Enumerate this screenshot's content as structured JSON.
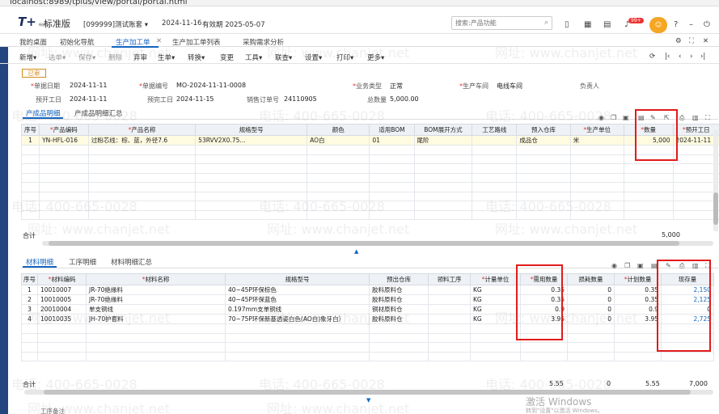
{
  "browser": {
    "url": "localhost:8989/tplus/view/portal/portal.html"
  },
  "header": {
    "logo": "T+",
    "logo_sub": "畅捷通",
    "edition": "标准版",
    "account": "[099999]测试账套",
    "date": "2024-11-16",
    "expiry": "有效期 2025-05-07",
    "search_placeholder": "搜索:产品功能",
    "notification_count": "99+"
  },
  "tabs": [
    {
      "label": "我的桌面"
    },
    {
      "label": "初始化导航"
    },
    {
      "label": "生产加工单"
    },
    {
      "label": "生产加工单列表"
    },
    {
      "label": "采购需求分析"
    }
  ],
  "toolbar": {
    "items": [
      "新增",
      "选单",
      "保存",
      "删除",
      "弃审",
      "生单",
      "转换",
      "变更",
      "工具",
      "联查",
      "设置",
      "打印",
      "更多"
    ]
  },
  "form": {
    "status": "已审",
    "fields": [
      {
        "label": "单据日期",
        "value": "2024-11-11",
        "required": true
      },
      {
        "label": "单据编号",
        "value": "MO-2024-11-11-0008",
        "required": true
      },
      {
        "label": "业务类型",
        "value": "正常",
        "required": true
      },
      {
        "label": "生产车间",
        "value": "电线车间",
        "required": true
      },
      {
        "label": "负责人",
        "value": "",
        "required": false
      },
      {
        "label": "预开工日",
        "value": "2024-11-11",
        "required": false
      },
      {
        "label": "预完工日",
        "value": "2024-11-15",
        "required": false
      },
      {
        "label": "销售订单号",
        "value": "24110905",
        "required": false
      },
      {
        "label": "总数量",
        "value": "5,000.00",
        "required": false
      }
    ]
  },
  "product_tabs": [
    {
      "label": "产成品明细"
    },
    {
      "label": "产成品明细汇总"
    }
  ],
  "product_grid": {
    "headers": [
      "序号",
      "产品编码",
      "产品名称",
      "规格型号",
      "颜色",
      "适用BOM",
      "BOM展开方式",
      "工艺路线",
      "预入仓库",
      "生产单位",
      "数量",
      "预开工日"
    ],
    "rows": [
      [
        "1",
        "YN-HFL-016",
        "过粉芯线：棕、蓝，外径7.6",
        "53RVV2X0.75...",
        "AO白",
        "01",
        "尾阶",
        "",
        "成品仓",
        "米",
        "5,000",
        "2024-11-11"
      ]
    ],
    "total_label": "合计",
    "total_qty": "5,000"
  },
  "material_tabs": [
    {
      "label": "材料明细"
    },
    {
      "label": "工序明细"
    },
    {
      "label": "材料明细汇总"
    }
  ],
  "material_grid": {
    "headers": [
      "序号",
      "材料编码",
      "材料名称",
      "规格型号",
      "预出仓库",
      "领料工序",
      "计量单位",
      "需用数量",
      "损耗数量",
      "计划数量",
      "现存量"
    ],
    "rows": [
      [
        "1",
        "10010007",
        "JR-70绝缘料",
        "40~45P环保棕色",
        "胶料原料仓",
        "",
        "KG",
        "0.35",
        "0",
        "0.35",
        "2,150"
      ],
      [
        "2",
        "10010005",
        "JR-70绝缘料",
        "40~45P环保蓝色",
        "胶料原料仓",
        "",
        "KG",
        "0.35",
        "0",
        "0.35",
        "2,125"
      ],
      [
        "3",
        "20010004",
        "单支铜线",
        "0.197mm支单铜线",
        "铜材原料仓",
        "",
        "KG",
        "0.9",
        "0",
        "0.9",
        "0"
      ],
      [
        "4",
        "10010035",
        "JH-70护套料",
        "70~75P环保新基透姿白色(AO白)象牙白）",
        "胶料原料仓",
        "",
        "KG",
        "3.95",
        "0",
        "3.95",
        "2,725"
      ]
    ],
    "total_label": "合计",
    "total_need": "5.55",
    "total_loss": "0",
    "total_plan": "5.55",
    "total_stock": "7,000"
  },
  "watermark": {
    "phone": "电话: 400-665-0028",
    "site": "网址: www.chanjet.net"
  },
  "windows": {
    "activate": "激活 Windows",
    "hint": "转到\"设置\"以激活 Windows。"
  },
  "bottom_label": "工序备注"
}
